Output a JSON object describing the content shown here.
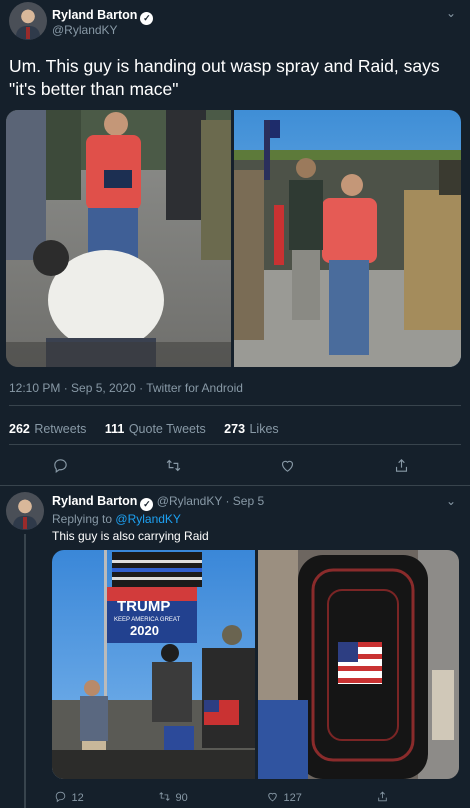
{
  "main_tweet": {
    "author_name": "Ryland Barton",
    "author_handle": "@RylandKY",
    "text": "Um. This guy is handing out wasp spray and Raid, says \"it's better than mace\"",
    "timestamp": "12:10 PM · Sep 5, 2020 · Twitter for Android",
    "stats": {
      "retweets_count": "262",
      "retweets_label": "Retweets",
      "quote_count": "111",
      "quote_label": "Quote Tweets",
      "likes_count": "273",
      "likes_label": "Likes"
    }
  },
  "reply_tweet": {
    "author_name": "Ryland Barton",
    "author_handle": "@RylandKY",
    "date": "· Sep 5",
    "replying_prefix": "Replying to",
    "replying_to": "@RylandKY",
    "text": "This guy is also carrying Raid",
    "actions": {
      "reply_count": "12",
      "retweet_count": "90",
      "like_count": "127"
    },
    "flag_text": {
      "trump": "TRUMP",
      "keep": "KEEP AMERICA GREAT",
      "year": "2020"
    }
  },
  "icons": [
    "verified-icon",
    "chevron-down-icon",
    "reply-icon",
    "retweet-icon",
    "like-icon",
    "share-icon"
  ],
  "colors": {
    "background": "#15202b",
    "secondary_text": "#8899a6",
    "link": "#1da1f2",
    "divider": "#38444d"
  }
}
